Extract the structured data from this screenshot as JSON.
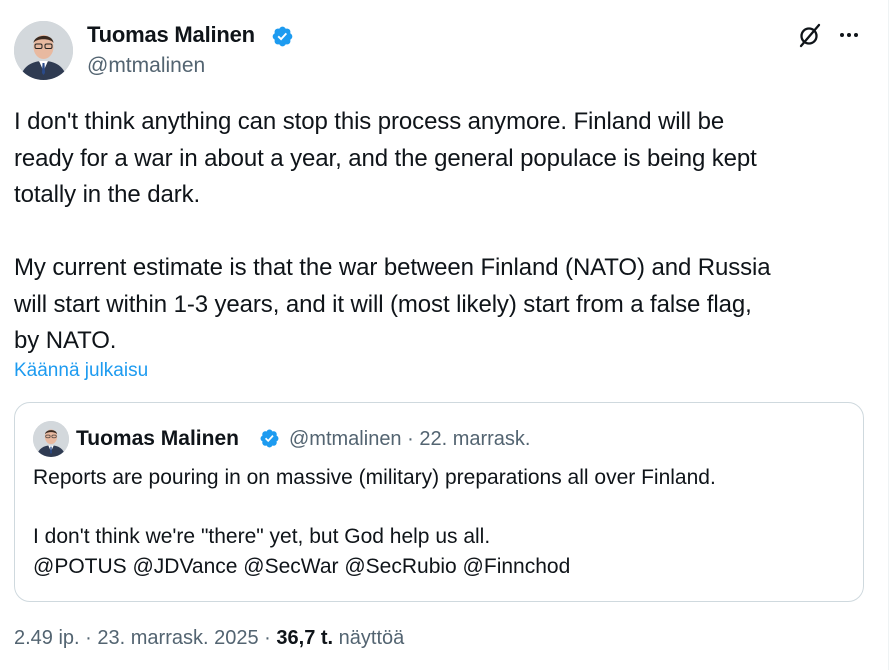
{
  "author": {
    "name": "Tuomas Malinen",
    "handle": "@mtmalinen",
    "verified_color": "#1d9bf0"
  },
  "post": {
    "text": "I don't think anything can stop this process anymore. Finland will be\nready for a war in about a year, and the general populace is being kept\ntotally in the dark.\n\nMy current estimate is that the war between Finland (NATO) and Russia\nwill start within 1-3 years, and it will (most likely) start from a false flag,\nby NATO.",
    "translate_label": "Käännä julkaisu"
  },
  "quote": {
    "name": "Tuomas Malinen",
    "meta": "@mtmalinen · 22. marrask.",
    "text": "Reports are pouring in on massive (military) preparations all over Finland.\n\nI don't think we're \"there\" yet, but God help us all.\n@POTUS @JDVance @SecWar @SecRubio @Finnchod"
  },
  "footer": {
    "time": "2.49 ip.",
    "separator": "·",
    "date": "23. marrask. 2025",
    "views_count": "36,7 t.",
    "views_label": "näyttöä"
  },
  "icons": {
    "verified": "verified-badge-icon",
    "grok": "grok-icon",
    "more": "more-options-icon"
  }
}
